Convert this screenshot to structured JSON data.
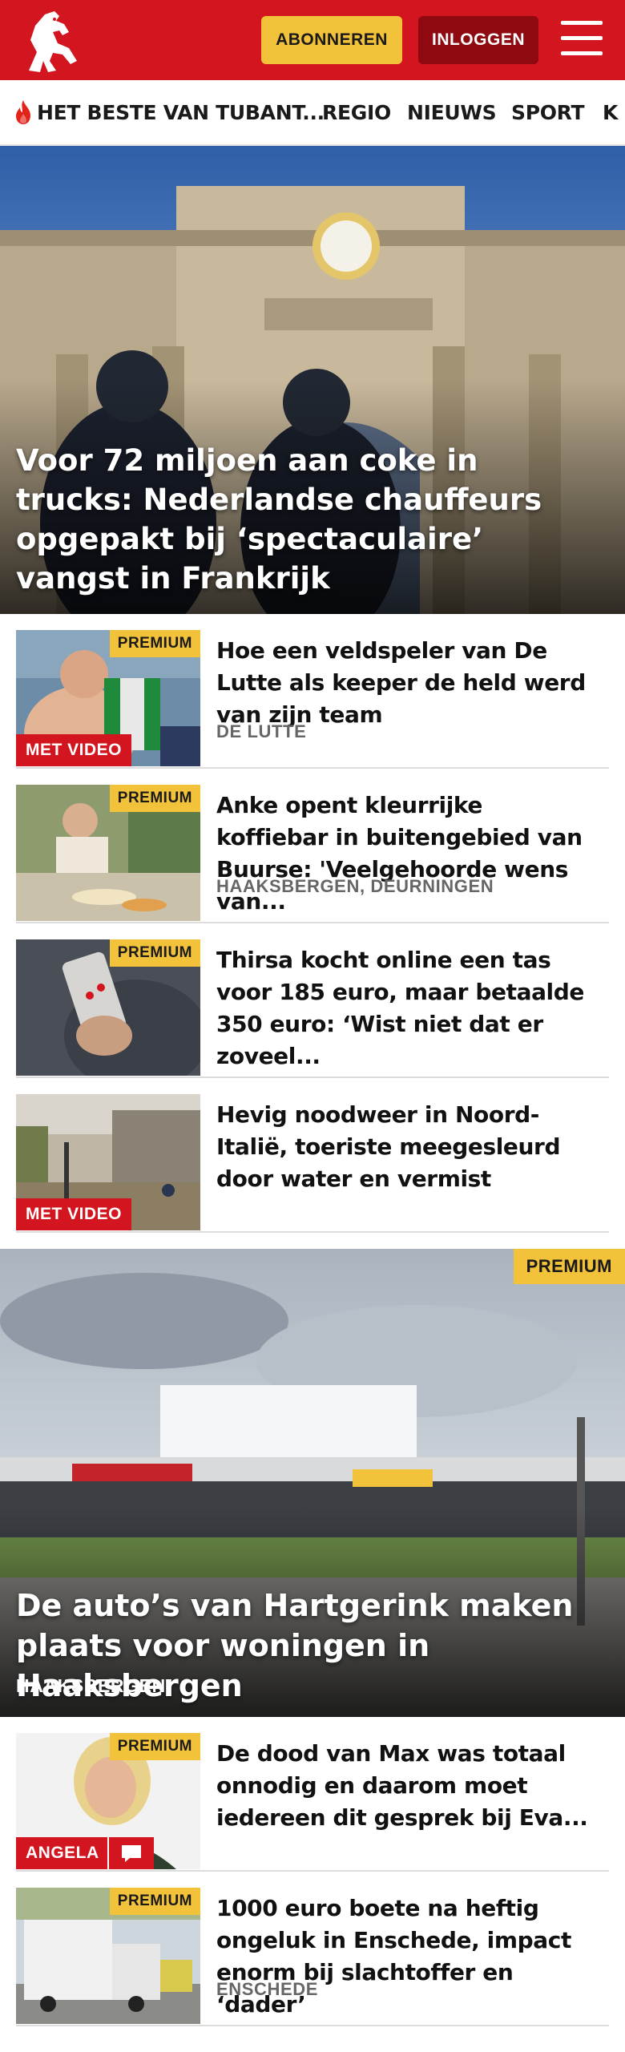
{
  "header": {
    "logo_icon": "tubantia-horse-logo-icon",
    "subscribe_label": "ABONNEREN",
    "login_label": "INLOGGEN",
    "menu_icon": "hamburger-menu-icon",
    "brand_color": "#d2151f",
    "accent_color": "#f2c23a"
  },
  "nav": {
    "items": [
      {
        "label": "HET BESTE VAN TUBANT...",
        "icon": "flame-icon"
      },
      {
        "label": "REGIO"
      },
      {
        "label": "NIEUWS"
      },
      {
        "label": "SPORT"
      },
      {
        "label": "K"
      }
    ]
  },
  "hero": {
    "title": "Voor 72 miljoen aan coke in trucks: Nederlandse chauffeurs opgepakt bij ‘spectaculaire’ vangst in Frankrijk"
  },
  "articles": [
    {
      "title": "Hoe een veldspeler van De Lutte als keeper de held werd van zijn team",
      "location": "DE LUTTE",
      "premium": "PREMIUM",
      "video": "MET VIDEO"
    },
    {
      "title": "Anke opent kleurrijke koffiebar in buitengebied van Buurse: 'Veelgehoorde wens van...",
      "location": "HAAKSBERGEN, DEURNINGEN",
      "premium": "PREMIUM"
    },
    {
      "title": "Thirsa kocht online een tas voor 185 euro, maar betaalde 350 euro: ‘Wist niet dat er zoveel...",
      "premium": "PREMIUM"
    },
    {
      "title": "Hevig noodweer in Noord-Italië, toeriste meegesleurd door water en vermist",
      "video": "MET VIDEO"
    }
  ],
  "feature": {
    "premium": "PREMIUM",
    "title": "De auto’s van Hartgerink maken plaats voor woningen in Haaksbergen",
    "location": "HAAKSBERGEN"
  },
  "articles2": [
    {
      "title": "De dood van Max was totaal onnodig en daarom moet iedereen dit gesprek bij Eva...",
      "premium": "PREMIUM",
      "author_badge": "ANGELA",
      "comment_icon": "comment-bubble-icon"
    },
    {
      "title": "1000 euro boete na heftig ongeluk in Enschede, impact enorm bij slachtoffer en ‘dader’",
      "location": "ENSCHEDE",
      "premium": "PREMIUM"
    }
  ]
}
